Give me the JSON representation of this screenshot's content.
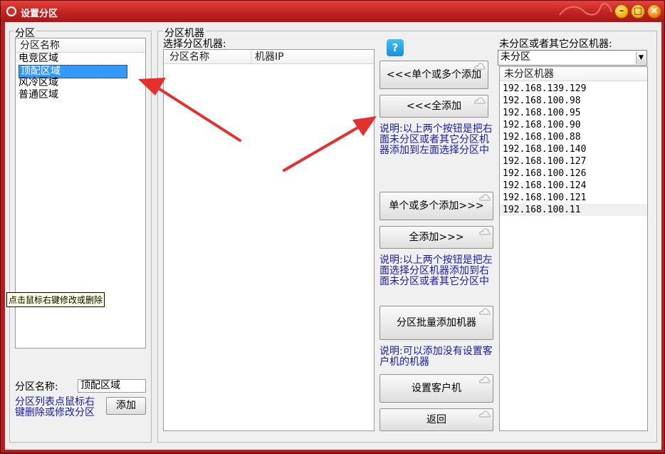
{
  "window": {
    "title": "设置分区"
  },
  "left": {
    "group_label": "分区",
    "column_header": "分区名称",
    "items": [
      "电竞区域",
      "顶配区域",
      "风冷区域",
      "普通区域"
    ],
    "selected_index": 1,
    "tooltip": "点击鼠标右键修改或删除",
    "name_label": "分区名称:",
    "name_value": "顶配区域",
    "add_button": "添加",
    "hint": "分区列表点鼠标右键删除或修改分区"
  },
  "middle": {
    "group_label": "分区机器",
    "list_label": "选择分区机器:",
    "col_name": "分区名称",
    "col_ip": "机器IP",
    "help_icon_text": "?"
  },
  "buttons": {
    "add_selected_left": "<<<单个或多个添加",
    "add_all_left": "<<<全添加",
    "note1": "说明:以上两个按钮是把右面未分区或者其它分区机器添加到左面选择分区中",
    "add_selected_right": "单个或多个添加>>>",
    "add_all_right": "全添加>>>",
    "note2": "说明:以上两个按钮是把左面选择分区机器添加到右面未分区或者其它分区中",
    "batch_add": "分区批量添加机器",
    "note3": "说明:可以添加没有设置客户机的机器",
    "set_client": "设置客户机",
    "back": "返回"
  },
  "right": {
    "label": "未分区或者其它分区机器:",
    "combo_value": "未分区",
    "column_header": "未分区机器",
    "ips": [
      "192.168.139.129",
      "192.168.100.98",
      "192.168.100.95",
      "192.168.100.90",
      "192.168.100.88",
      "192.168.100.140",
      "192.168.100.127",
      "192.168.100.126",
      "192.168.100.124",
      "192.168.100.121",
      "192.168.100.11"
    ]
  },
  "colors": {
    "title_bar": "#c02420",
    "selection": "#3399ff",
    "note_text": "#1a1aa8",
    "arrow": "#e53030"
  }
}
